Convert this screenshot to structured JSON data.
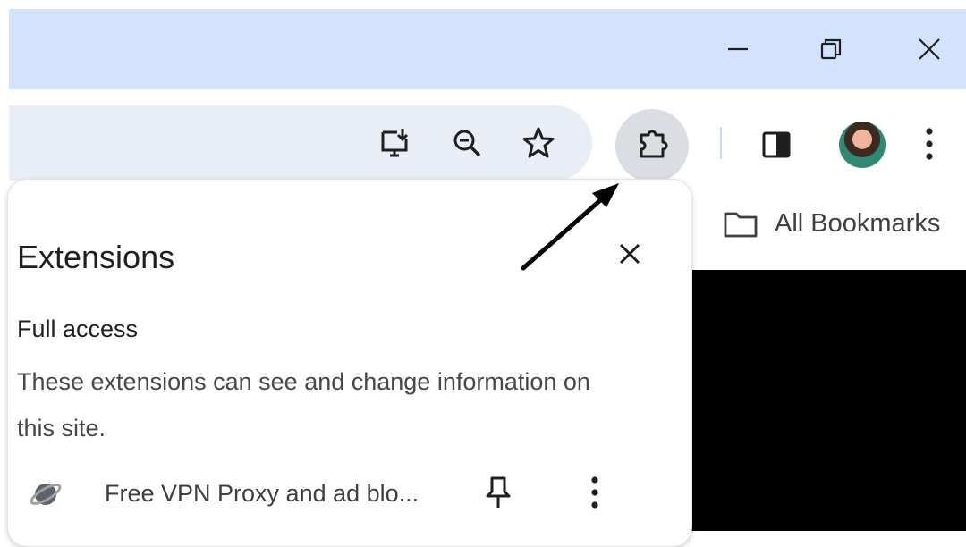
{
  "window_controls": {
    "minimize_icon": "minimize-icon",
    "restore_icon": "restore-icon",
    "close_icon": "close-icon"
  },
  "toolbar": {
    "icons": [
      "install-app-icon",
      "zoom-icon",
      "bookmark-star-icon",
      "extensions-puzzle-icon",
      "side-panel-icon",
      "profile-avatar",
      "more-menu-icon"
    ]
  },
  "bookmarks_bar": {
    "folder_label": "All Bookmarks"
  },
  "extensions_popup": {
    "title": "Extensions",
    "section_heading": "Full access",
    "section_description": "These extensions can see and change information on this site.",
    "items": [
      {
        "name": "Free VPN Proxy and ad blo...",
        "icon": "planet-icon"
      }
    ]
  },
  "colors": {
    "titlebar": "#d3e3fd",
    "omnibox": "#e9eef6",
    "extensions_button_active": "#dadde2",
    "text_primary": "#1f1f1f",
    "text_secondary": "#474747"
  }
}
